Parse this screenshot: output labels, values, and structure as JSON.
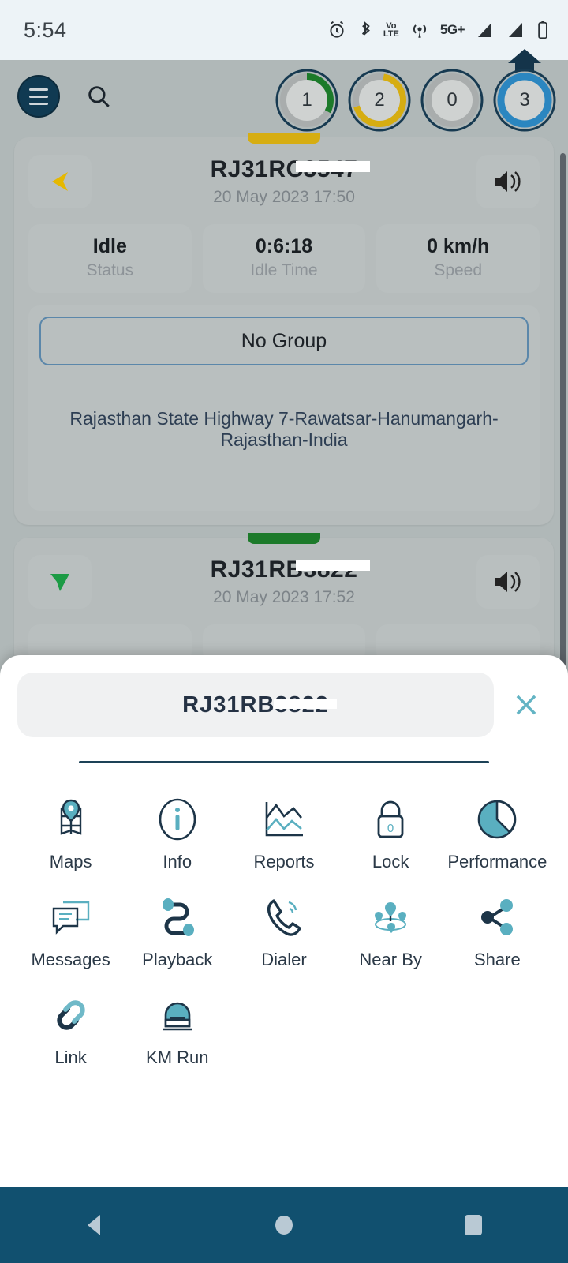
{
  "status_bar": {
    "time": "5:54",
    "icons": [
      "alarm-icon",
      "bluetooth-icon",
      "volte-icon",
      "hotspot-icon",
      "5g-icon",
      "signal-1-icon",
      "signal-2-icon",
      "battery-icon"
    ],
    "volte_top": "Vo",
    "volte_bottom": "LTE",
    "network_label": "5G+"
  },
  "topbar": {
    "menu_icon": "hamburger-icon",
    "search_icon": "search-icon",
    "counters": [
      {
        "value": "1",
        "color": "#1c7a2a",
        "arc": 0.33,
        "name": "running-count"
      },
      {
        "value": "2",
        "color": "#d6ad12",
        "arc": 0.68,
        "name": "idle-count"
      },
      {
        "value": "0",
        "color": "#a8acac",
        "arc": 0,
        "name": "stopped-count"
      },
      {
        "value": "3",
        "color": "#2b86c0",
        "arc": 1,
        "name": "total-count"
      }
    ]
  },
  "vehicles": [
    {
      "plate": "RJ31RC3547",
      "timestamp": "20 May 2023 17:50",
      "tab_color": "#d6ad12",
      "arrow_color": "#e6b800",
      "arrow_dir": "left",
      "stats": [
        {
          "value": "Idle",
          "label": "Status"
        },
        {
          "value": "0:6:18",
          "label": "Idle Time"
        },
        {
          "value": "0 km/h",
          "label": "Speed"
        }
      ],
      "group": "No Group",
      "address": "Rajasthan State Highway 7-Rawatsar-Hanumangarh-Rajasthan-India",
      "speaker_icon": "speaker-icon"
    },
    {
      "plate": "RJ31RB3822",
      "timestamp": "20 May 2023 17:52",
      "tab_color": "#1c7a2a",
      "arrow_color": "#1c9b45",
      "arrow_dir": "down",
      "stats": [],
      "group": "",
      "address": "",
      "speaker_icon": "speaker-icon"
    }
  ],
  "sheet": {
    "title": "RJ31RB3822",
    "close_icon": "close-icon",
    "actions": [
      {
        "label": "Maps",
        "icon": "map-pin-icon"
      },
      {
        "label": "Info",
        "icon": "info-icon"
      },
      {
        "label": "Reports",
        "icon": "line-chart-icon"
      },
      {
        "label": "Lock",
        "icon": "lock-icon",
        "badge": "0"
      },
      {
        "label": "Performance",
        "icon": "pie-chart-icon"
      },
      {
        "label": "Messages",
        "icon": "chat-bubble-icon"
      },
      {
        "label": "Playback",
        "icon": "route-icon"
      },
      {
        "label": "Dialer",
        "icon": "phone-icon"
      },
      {
        "label": "Near By",
        "icon": "nearby-pins-icon"
      },
      {
        "label": "Share",
        "icon": "share-icon"
      },
      {
        "label": "Link",
        "icon": "chain-link-icon"
      },
      {
        "label": "KM Run",
        "icon": "odometer-icon"
      }
    ]
  },
  "navbar": {
    "back": "back-icon",
    "home": "home-icon",
    "recents": "recents-icon"
  },
  "colors": {
    "accent_teal": "#5aafc0",
    "accent_navy": "#1d3548",
    "navbar": "#11506f",
    "sheet_bg": "#ffffff"
  }
}
